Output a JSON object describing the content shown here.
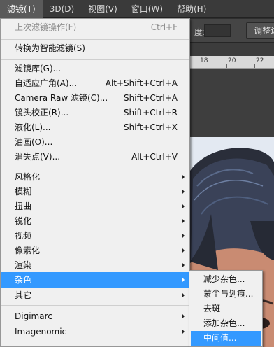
{
  "menubar": {
    "items": [
      "滤镜(T)",
      "3D(D)",
      "视图(V)",
      "窗口(W)",
      "帮助(H)"
    ]
  },
  "optionsbar": {
    "fragment_label": "度:",
    "adjust_button": "调整边"
  },
  "ruler": {
    "ticks": [
      "18",
      "20",
      "22"
    ]
  },
  "filter_menu": {
    "items": [
      {
        "label": "上次滤镜操作(F)",
        "shortcut": "Ctrl+F"
      },
      {
        "label": "转换为智能滤镜(S)",
        "shortcut": ""
      },
      {
        "label": "滤镜库(G)...",
        "shortcut": ""
      },
      {
        "label": "自适应广角(A)...",
        "shortcut": "Alt+Shift+Ctrl+A"
      },
      {
        "label": "Camera Raw 滤镜(C)...",
        "shortcut": "Shift+Ctrl+A"
      },
      {
        "label": "镜头校正(R)...",
        "shortcut": "Shift+Ctrl+R"
      },
      {
        "label": "液化(L)...",
        "shortcut": "Shift+Ctrl+X"
      },
      {
        "label": "油画(O)...",
        "shortcut": ""
      },
      {
        "label": "消失点(V)...",
        "shortcut": "Alt+Ctrl+V"
      },
      {
        "label": "风格化",
        "shortcut": ""
      },
      {
        "label": "模糊",
        "shortcut": ""
      },
      {
        "label": "扭曲",
        "shortcut": ""
      },
      {
        "label": "锐化",
        "shortcut": ""
      },
      {
        "label": "视频",
        "shortcut": ""
      },
      {
        "label": "像素化",
        "shortcut": ""
      },
      {
        "label": "渲染",
        "shortcut": ""
      },
      {
        "label": "杂色",
        "shortcut": ""
      },
      {
        "label": "其它",
        "shortcut": ""
      },
      {
        "label": "Digimarc",
        "shortcut": ""
      },
      {
        "label": "Imagenomic",
        "shortcut": ""
      }
    ]
  },
  "noise_submenu": {
    "items": [
      "减少杂色...",
      "蒙尘与划痕...",
      "去斑",
      "添加杂色...",
      "中间值..."
    ]
  },
  "colors": {
    "highlight": "#3399ff",
    "menu_bg": "#f0f0f0",
    "menubar_bg": "#3a3a3a"
  }
}
